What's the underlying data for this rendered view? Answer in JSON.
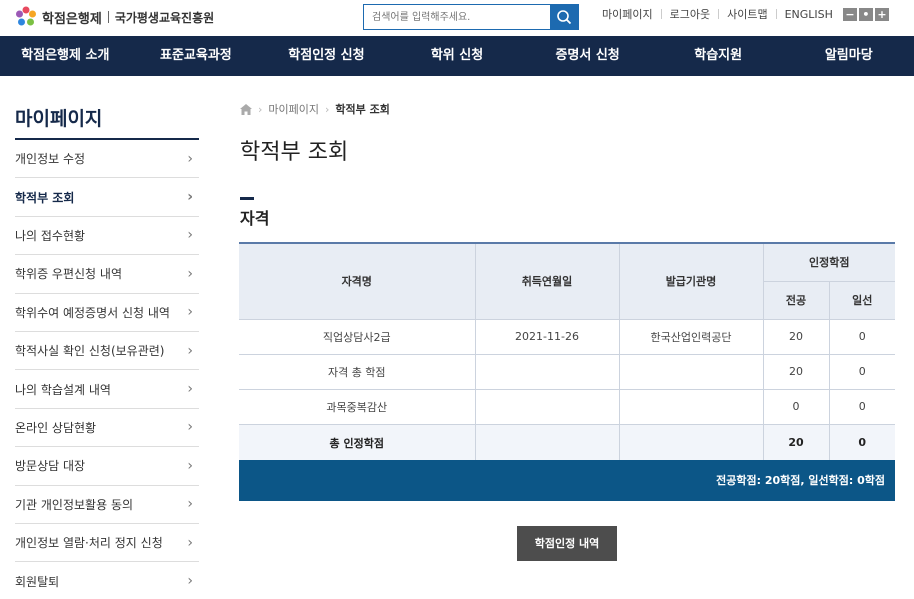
{
  "header": {
    "logo_name": "학점은행제",
    "org_name": "국가평생교육진흥원",
    "search_placeholder": "검색어를 입력해주세요.",
    "util_links": [
      "마이페이지",
      "로그아웃",
      "사이트맵",
      "ENGLISH"
    ],
    "zoom": [
      "−",
      "•",
      "+"
    ]
  },
  "nav": [
    "학점은행제 소개",
    "표준교육과정",
    "학점인정 신청",
    "학위 신청",
    "증명서 신청",
    "학습지원",
    "알림마당"
  ],
  "sidebar": {
    "title": "마이페이지",
    "items": [
      {
        "label": "개인정보 수정"
      },
      {
        "label": "학적부 조회"
      },
      {
        "label": "나의 접수현황"
      },
      {
        "label": "학위증 우편신청 내역"
      },
      {
        "label": "학위수여 예정증명서 신청 내역"
      },
      {
        "label": "학적사실 확인 신청(보유관련)"
      },
      {
        "label": "나의 학습설계 내역"
      },
      {
        "label": "온라인 상담현황"
      },
      {
        "label": "방문상담 대장"
      },
      {
        "label": "기관 개인정보활용 동의"
      },
      {
        "label": "개인정보 열람·처리 정지 신청"
      },
      {
        "label": "회원탈퇴"
      }
    ],
    "chevron": "›"
  },
  "breadcrumb": {
    "items": [
      "마이페이지",
      "학적부 조회"
    ]
  },
  "page_title": "학적부 조회",
  "section_title": "자격",
  "table": {
    "headers": {
      "name": "자격명",
      "date": "취득연월일",
      "issuer": "발급기관명",
      "credit": "인정학점",
      "major": "전공",
      "general": "일선"
    },
    "rows": [
      {
        "name": "직업상담사2급",
        "date": "2021-11-26",
        "issuer": "한국산업인력공단",
        "major": "20",
        "general": "0"
      },
      {
        "name": "자격 총 학점",
        "date": "",
        "issuer": "",
        "major": "20",
        "general": "0"
      },
      {
        "name": "과목중복감산",
        "date": "",
        "issuer": "",
        "major": "0",
        "general": "0"
      }
    ],
    "total": {
      "name": "총 인정학점",
      "date": "",
      "issuer": "",
      "major": "20",
      "general": "0"
    }
  },
  "summary": "전공학점: 20학점, 일선학점: 0학점",
  "button_label": "학점인정 내역",
  "colors": {
    "nav_bg": "#15294a",
    "accent": "#1d6ab0",
    "summary_bg": "#0c5687"
  }
}
